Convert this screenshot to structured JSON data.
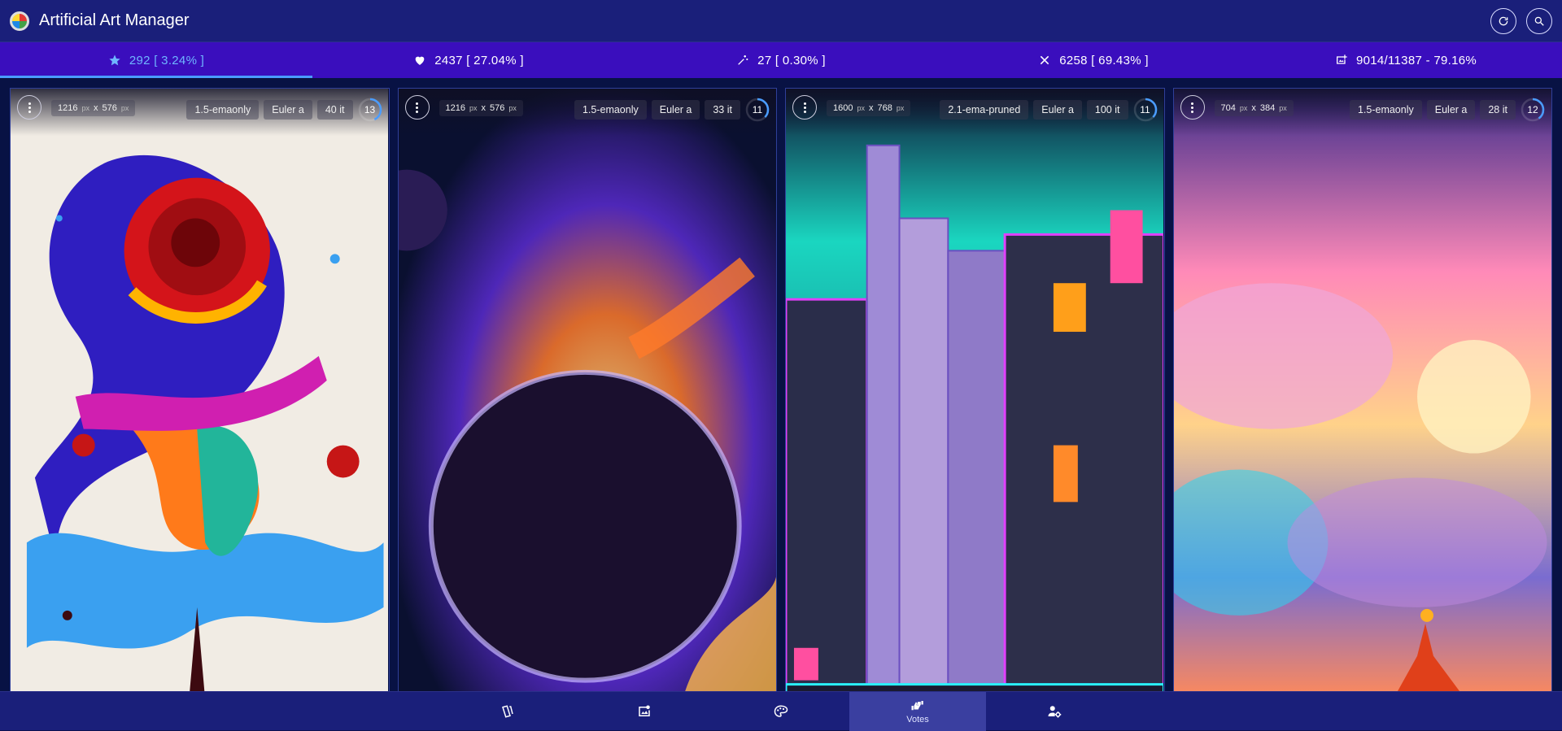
{
  "app": {
    "title": "Artificial Art Manager"
  },
  "header": {
    "icons": [
      "refresh-icon",
      "search-icon"
    ]
  },
  "stats": [
    {
      "icon": "star-icon",
      "label": "292 [ 3.24% ]",
      "active": true
    },
    {
      "icon": "heart-icon",
      "label": "2437 [ 27.04% ]"
    },
    {
      "icon": "sparkle-icon",
      "label": "27 [ 0.30% ]"
    },
    {
      "icon": "close-icon",
      "label": "6258 [ 69.43% ]"
    },
    {
      "icon": "image-count-icon",
      "label": "9014/11387 - 79.16%"
    }
  ],
  "cards": [
    {
      "width": "1216",
      "height": "576",
      "px": "px",
      "x": "x",
      "model": "1.5-emaonly",
      "sampler": "Euler a",
      "steps": "40 it",
      "cfg": "13",
      "cfg_fraction": 0.43
    },
    {
      "width": "1216",
      "height": "576",
      "px": "px",
      "x": "x",
      "model": "1.5-emaonly",
      "sampler": "Euler a",
      "steps": "33 it",
      "cfg": "11",
      "cfg_fraction": 0.37
    },
    {
      "width": "1600",
      "height": "768",
      "px": "px",
      "x": "x",
      "model": "2.1-ema-pruned",
      "sampler": "Euler a",
      "steps": "100 it",
      "cfg": "11",
      "cfg_fraction": 0.37
    },
    {
      "width": "704",
      "height": "384",
      "px": "px",
      "x": "x",
      "model": "1.5-emaonly",
      "sampler": "Euler a",
      "steps": "28 it",
      "cfg": "12",
      "cfg_fraction": 0.4
    }
  ],
  "bottom_nav": [
    {
      "icon": "cards-icon",
      "label": ""
    },
    {
      "icon": "gallery-icon",
      "label": ""
    },
    {
      "icon": "palette-icon",
      "label": ""
    },
    {
      "icon": "votes-icon",
      "label": "Votes",
      "active": true
    },
    {
      "icon": "user-settings-icon",
      "label": ""
    }
  ],
  "colors": {
    "accent": "#4a9cff",
    "header": "#1a1f7a",
    "stats_bar": "#3a0ebd"
  }
}
